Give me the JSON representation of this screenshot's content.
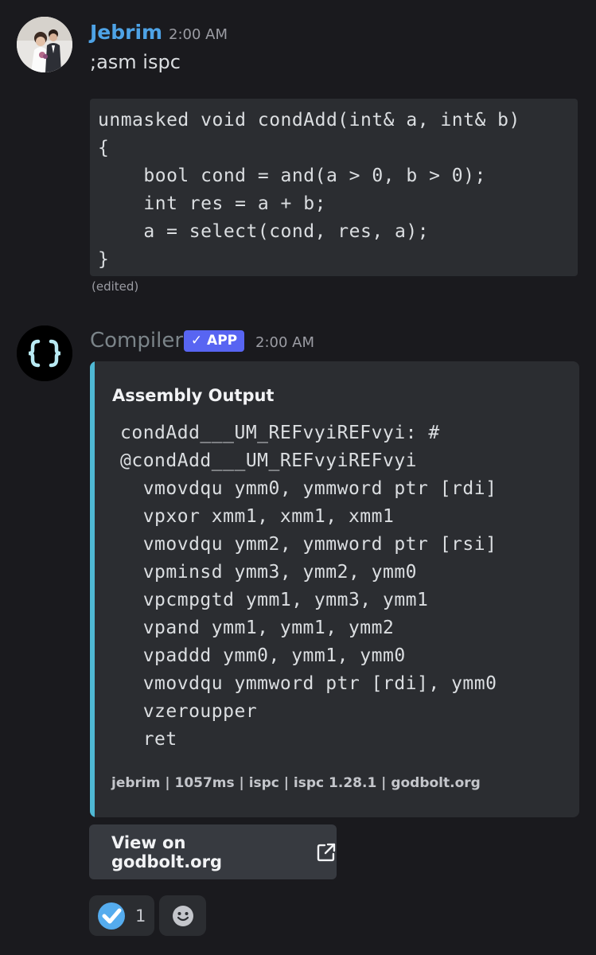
{
  "messages": [
    {
      "author": "Jebrim",
      "timestamp": "2:00 AM",
      "text": ";asm ispc",
      "code": [
        "unmasked void condAdd(int& a, int& b)",
        "{",
        "    bool cond = and(a > 0, b > 0);",
        "    int res = a + b;",
        "    a = select(cond, res, a);",
        "}"
      ],
      "edited_label": "(edited)",
      "author_color": "#4ea3e6"
    },
    {
      "author": "Compiler",
      "badge": "✓ APP",
      "timestamp": "2:00 AM",
      "embed": {
        "title": "Assembly Output",
        "accent_color": "#4fb8d4",
        "code": [
          "condAdd___UM_REFvyiREFvyi: #",
          "@condAdd___UM_REFvyiREFvyi",
          "  vmovdqu ymm0, ymmword ptr [rdi]",
          "  vpxor xmm1, xmm1, xmm1",
          "  vmovdqu ymm2, ymmword ptr [rsi]",
          "  vpminsd ymm3, ymm2, ymm0",
          "  vpcmpgtd ymm1, ymm3, ymm1",
          "  vpand ymm1, ymm1, ymm2",
          "  vpaddd ymm0, ymm1, ymm0",
          "  vmovdqu ymmword ptr [rdi], ymm0",
          "  vzeroupper",
          "  ret"
        ],
        "footer": "jebrim | 1057ms | ispc | ispc 1.28.1 | godbolt.org"
      },
      "button": {
        "label": "View on godbolt.org",
        "icon": "external-link-icon"
      },
      "reactions": [
        {
          "icon": "check-emoji-icon",
          "count": "1"
        }
      ],
      "add_reaction_icon": "smiley-icon"
    }
  ]
}
